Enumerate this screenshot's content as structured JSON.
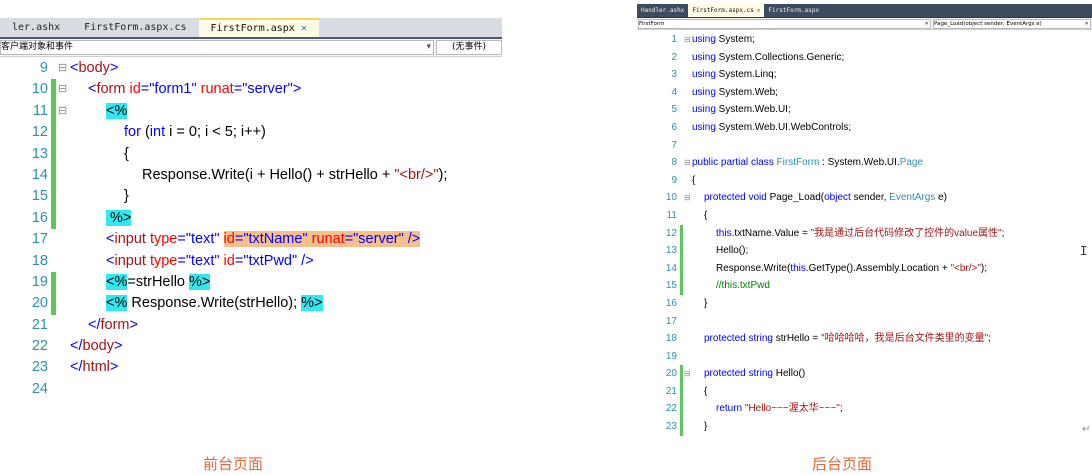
{
  "colors": {
    "tag": "#a31515",
    "attr": "#ff0000",
    "value": "#0000ff",
    "keyword": "#0000ff",
    "type": "#2b91af",
    "comment": "#008000",
    "text": "#000000",
    "number": "#2b91af",
    "change_green": "#5cc85c",
    "change_yellow": "#f5e042",
    "server_hl": "#30e8f0",
    "selection": "#f6c08d",
    "caption": "#e06a3c"
  },
  "left": {
    "tabs": [
      {
        "label": "ler.ashx",
        "active": false,
        "close": false
      },
      {
        "label": "FirstForm.aspx.cs",
        "active": false,
        "close": false
      },
      {
        "label": "FirstForm.aspx",
        "active": true,
        "close": true
      }
    ],
    "close_glyph": "✕",
    "combo_left": "客户端对象和事件",
    "combo_right": "(无事件)",
    "arrow": "▾",
    "lines": [
      {
        "n": "9",
        "fold": "⊟",
        "change": "",
        "indent": 0,
        "tokens": [
          {
            "t": "<",
            "c": "value"
          },
          {
            "t": "body",
            "c": "tag"
          },
          {
            "t": ">",
            "c": "value"
          }
        ]
      },
      {
        "n": "10",
        "fold": "⊟",
        "change": "green",
        "indent": 1,
        "tokens": [
          {
            "t": "<",
            "c": "value"
          },
          {
            "t": "form",
            "c": "tag"
          },
          {
            "t": " ",
            "c": "text"
          },
          {
            "t": "id",
            "c": "attr"
          },
          {
            "t": "=",
            "c": "value"
          },
          {
            "t": "\"form1\"",
            "c": "value"
          },
          {
            "t": " ",
            "c": "text"
          },
          {
            "t": "runat",
            "c": "attr"
          },
          {
            "t": "=",
            "c": "value"
          },
          {
            "t": "\"server\"",
            "c": "value"
          },
          {
            "t": ">",
            "c": "value"
          }
        ]
      },
      {
        "n": "11",
        "fold": "⊟",
        "change": "green",
        "indent": 2,
        "tokens": [
          {
            "t": "<%",
            "c": "text",
            "hl": true
          }
        ]
      },
      {
        "n": "12",
        "fold": "",
        "change": "green",
        "indent": 3,
        "tokens": [
          {
            "t": "for",
            "c": "keyword"
          },
          {
            "t": " (",
            "c": "text"
          },
          {
            "t": "int",
            "c": "keyword"
          },
          {
            "t": " i = 0; i < 5; i++)",
            "c": "text"
          }
        ]
      },
      {
        "n": "13",
        "fold": "",
        "change": "green",
        "indent": 3,
        "tokens": [
          {
            "t": "{",
            "c": "text"
          }
        ]
      },
      {
        "n": "14",
        "fold": "",
        "change": "green",
        "indent": 4,
        "tokens": [
          {
            "t": "Response.Write(i + Hello() + strHello + ",
            "c": "text"
          },
          {
            "t": "\"<br/>\"",
            "c": "tag"
          },
          {
            "t": ");",
            "c": "text"
          }
        ]
      },
      {
        "n": "15",
        "fold": "",
        "change": "green",
        "indent": 3,
        "tokens": [
          {
            "t": "}",
            "c": "text"
          }
        ]
      },
      {
        "n": "16",
        "fold": "",
        "change": "green",
        "indent": 2,
        "tokens": [
          {
            "t": " %>",
            "c": "text",
            "hl": true
          }
        ]
      },
      {
        "n": "17",
        "fold": "",
        "change": "",
        "indent": 2,
        "tokens": [
          {
            "t": "<",
            "c": "value"
          },
          {
            "t": "input",
            "c": "tag"
          },
          {
            "t": " ",
            "c": "text"
          },
          {
            "t": "type",
            "c": "attr"
          },
          {
            "t": "=",
            "c": "value"
          },
          {
            "t": "\"text\"",
            "c": "value"
          },
          {
            "t": " ",
            "c": "text"
          },
          {
            "t": "id",
            "c": "attr",
            "sel": true
          },
          {
            "t": "=",
            "c": "value",
            "sel": true
          },
          {
            "t": "\"txtName\"",
            "c": "value",
            "sel": true
          },
          {
            "t": " ",
            "c": "text",
            "sel": true
          },
          {
            "t": "runat",
            "c": "attr",
            "sel": true
          },
          {
            "t": "=",
            "c": "value",
            "sel": true
          },
          {
            "t": "\"server\"",
            "c": "value",
            "sel": true
          },
          {
            "t": " />",
            "c": "value",
            "sel": true
          }
        ]
      },
      {
        "n": "18",
        "fold": "",
        "change": "",
        "indent": 2,
        "tokens": [
          {
            "t": "<",
            "c": "value"
          },
          {
            "t": "input",
            "c": "tag"
          },
          {
            "t": " ",
            "c": "text"
          },
          {
            "t": "type",
            "c": "attr"
          },
          {
            "t": "=",
            "c": "value"
          },
          {
            "t": "\"text\"",
            "c": "value"
          },
          {
            "t": " ",
            "c": "text"
          },
          {
            "t": "id",
            "c": "attr"
          },
          {
            "t": "=",
            "c": "value"
          },
          {
            "t": "\"txtPwd\"",
            "c": "value"
          },
          {
            "t": " />",
            "c": "value"
          }
        ]
      },
      {
        "n": "19",
        "fold": "",
        "change": "green",
        "indent": 2,
        "tokens": [
          {
            "t": "<%",
            "c": "text",
            "hl": true
          },
          {
            "t": "=strHello ",
            "c": "text"
          },
          {
            "t": "%>",
            "c": "text",
            "hl": true
          }
        ]
      },
      {
        "n": "20",
        "fold": "",
        "change": "green",
        "indent": 2,
        "tokens": [
          {
            "t": "<%",
            "c": "text",
            "hl": true
          },
          {
            "t": " Response.Write(strHello); ",
            "c": "text"
          },
          {
            "t": "%>",
            "c": "text",
            "hl": true
          }
        ]
      },
      {
        "n": "21",
        "fold": "",
        "change": "",
        "indent": 1,
        "tokens": [
          {
            "t": "</",
            "c": "value"
          },
          {
            "t": "form",
            "c": "tag"
          },
          {
            "t": ">",
            "c": "value"
          }
        ]
      },
      {
        "n": "22",
        "fold": "",
        "change": "",
        "indent": 0,
        "tokens": [
          {
            "t": "</",
            "c": "value"
          },
          {
            "t": "body",
            "c": "tag"
          },
          {
            "t": ">",
            "c": "value"
          }
        ]
      },
      {
        "n": "23",
        "fold": "",
        "change": "",
        "indent": 0,
        "tokens": [
          {
            "t": "</",
            "c": "value"
          },
          {
            "t": "html",
            "c": "tag"
          },
          {
            "t": ">",
            "c": "value"
          }
        ]
      },
      {
        "n": "24",
        "fold": "",
        "change": "",
        "indent": 0,
        "tokens": []
      }
    ],
    "caption": "前台页面"
  },
  "right": {
    "tabs": [
      {
        "label": "Handler.ashx",
        "active": false,
        "close": false
      },
      {
        "label": "FirstForm.aspx.cs",
        "active": true,
        "close": true
      },
      {
        "label": "FirstForm.aspx",
        "active": false,
        "close": false
      }
    ],
    "close_glyph": "✕",
    "combo_left": "FirstForm",
    "combo_right": "Page_Load(object sender, EventArgs e)",
    "arrow": "▾",
    "lines": [
      {
        "n": "1",
        "fold": "⊟",
        "change": "",
        "indent": 0,
        "tokens": [
          {
            "t": "using",
            "c": "keyword"
          },
          {
            "t": " System;",
            "c": "text"
          }
        ]
      },
      {
        "n": "2",
        "fold": "",
        "change": "",
        "indent": 0,
        "tokens": [
          {
            "t": "using",
            "c": "keyword"
          },
          {
            "t": " System.Collections.Generic;",
            "c": "text"
          }
        ]
      },
      {
        "n": "3",
        "fold": "",
        "change": "",
        "indent": 0,
        "tokens": [
          {
            "t": "using",
            "c": "keyword"
          },
          {
            "t": " System.Linq;",
            "c": "text"
          }
        ]
      },
      {
        "n": "4",
        "fold": "",
        "change": "",
        "indent": 0,
        "tokens": [
          {
            "t": "using",
            "c": "keyword"
          },
          {
            "t": " System.Web;",
            "c": "text"
          }
        ]
      },
      {
        "n": "5",
        "fold": "",
        "change": "",
        "indent": 0,
        "tokens": [
          {
            "t": "using",
            "c": "keyword"
          },
          {
            "t": " System.Web.UI;",
            "c": "text"
          }
        ]
      },
      {
        "n": "6",
        "fold": "",
        "change": "",
        "indent": 0,
        "tokens": [
          {
            "t": "using",
            "c": "keyword"
          },
          {
            "t": " System.Web.UI.WebControls;",
            "c": "text"
          }
        ]
      },
      {
        "n": "7",
        "fold": "",
        "change": "",
        "indent": 0,
        "tokens": []
      },
      {
        "n": "8",
        "fold": "⊟",
        "change": "",
        "indent": 0,
        "tokens": [
          {
            "t": "public",
            "c": "keyword"
          },
          {
            "t": " ",
            "c": "text"
          },
          {
            "t": "partial",
            "c": "keyword"
          },
          {
            "t": " ",
            "c": "text"
          },
          {
            "t": "class",
            "c": "keyword"
          },
          {
            "t": " ",
            "c": "text"
          },
          {
            "t": "FirstForm",
            "c": "type"
          },
          {
            "t": " : System.Web.UI.",
            "c": "text"
          },
          {
            "t": "Page",
            "c": "type"
          }
        ]
      },
      {
        "n": "9",
        "fold": "",
        "change": "",
        "indent": 0,
        "tokens": [
          {
            "t": "{",
            "c": "text"
          }
        ]
      },
      {
        "n": "10",
        "fold": "⊟",
        "change": "",
        "indent": 1,
        "tokens": [
          {
            "t": "protected",
            "c": "keyword"
          },
          {
            "t": " ",
            "c": "text"
          },
          {
            "t": "void",
            "c": "keyword"
          },
          {
            "t": " Page_Load(",
            "c": "text"
          },
          {
            "t": "object",
            "c": "keyword"
          },
          {
            "t": " sender, ",
            "c": "text"
          },
          {
            "t": "EventArgs",
            "c": "type"
          },
          {
            "t": " e)",
            "c": "text"
          }
        ]
      },
      {
        "n": "11",
        "fold": "",
        "change": "",
        "indent": 1,
        "tokens": [
          {
            "t": "{",
            "c": "text"
          }
        ]
      },
      {
        "n": "12",
        "fold": "",
        "change": "green",
        "indent": 2,
        "tokens": [
          {
            "t": "this",
            "c": "keyword"
          },
          {
            "t": ".txtName.Value = ",
            "c": "text"
          },
          {
            "t": "\"我是通过后台代码修改了控件的value属性\"",
            "c": "tag"
          },
          {
            "t": ";",
            "c": "text"
          }
        ]
      },
      {
        "n": "13",
        "fold": "",
        "change": "green",
        "indent": 2,
        "tokens": [
          {
            "t": "Hello();",
            "c": "text"
          }
        ]
      },
      {
        "n": "14",
        "fold": "",
        "change": "green",
        "indent": 2,
        "tokens": [
          {
            "t": "Response.Write(",
            "c": "text"
          },
          {
            "t": "this",
            "c": "keyword"
          },
          {
            "t": ".GetType().Assembly.Location + ",
            "c": "text"
          },
          {
            "t": "\"<br/>\"",
            "c": "tag"
          },
          {
            "t": ");",
            "c": "text"
          }
        ]
      },
      {
        "n": "15",
        "fold": "",
        "change": "green",
        "indent": 2,
        "tokens": [
          {
            "t": "//this.txtPwd",
            "c": "comment"
          }
        ]
      },
      {
        "n": "16",
        "fold": "",
        "change": "",
        "indent": 1,
        "tokens": [
          {
            "t": "}",
            "c": "text"
          }
        ]
      },
      {
        "n": "17",
        "fold": "",
        "change": "",
        "indent": 0,
        "tokens": []
      },
      {
        "n": "18",
        "fold": "",
        "change": "",
        "indent": 1,
        "tokens": [
          {
            "t": "protected",
            "c": "keyword"
          },
          {
            "t": " ",
            "c": "text"
          },
          {
            "t": "string",
            "c": "keyword"
          },
          {
            "t": " strHello = ",
            "c": "text"
          },
          {
            "t": "\"哈哈哈哈，我是后台文件类里的变量\"",
            "c": "tag"
          },
          {
            "t": ";",
            "c": "text"
          }
        ]
      },
      {
        "n": "19",
        "fold": "",
        "change": "",
        "indent": 0,
        "tokens": []
      },
      {
        "n": "20",
        "fold": "⊟",
        "change": "green",
        "indent": 1,
        "tokens": [
          {
            "t": "protected",
            "c": "keyword"
          },
          {
            "t": " ",
            "c": "text"
          },
          {
            "t": "string",
            "c": "keyword"
          },
          {
            "t": " Hello()",
            "c": "text"
          }
        ]
      },
      {
        "n": "21",
        "fold": "",
        "change": "green",
        "indent": 1,
        "tokens": [
          {
            "t": "{",
            "c": "text"
          }
        ]
      },
      {
        "n": "22",
        "fold": "",
        "change": "green",
        "indent": 2,
        "tokens": [
          {
            "t": "return",
            "c": "keyword"
          },
          {
            "t": " ",
            "c": "text"
          },
          {
            "t": "\"Hello~~~渥太华~~~\"",
            "c": "tag"
          },
          {
            "t": ";",
            "c": "text"
          }
        ]
      },
      {
        "n": "23",
        "fold": "",
        "change": "green",
        "indent": 1,
        "tokens": [
          {
            "t": "}",
            "c": "text"
          }
        ]
      }
    ],
    "caption": "后台页面"
  },
  "marks": {
    "ibeam": "I",
    "return_mark": "↵"
  }
}
